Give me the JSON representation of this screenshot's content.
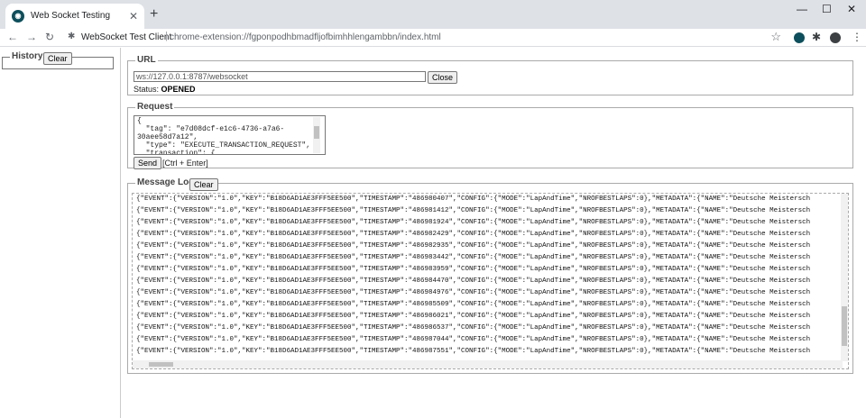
{
  "browser": {
    "tab_title": "Web Socket Testing",
    "tab_close": "✕",
    "new_tab": "+",
    "site_name": "WebSocket Test Client",
    "url": "chrome-extension://fgponpodhbmadfljofbimhhlengambbn/index.html",
    "win_min": "—",
    "win_max": "☐",
    "win_close": "✕"
  },
  "history": {
    "legend": "History",
    "clear_label": "Clear"
  },
  "url_section": {
    "legend": "URL",
    "input_value": "ws://127.0.0.1:8787/websocket",
    "close_label": "Close",
    "status_label": "Status:",
    "status_value": "OPENED"
  },
  "request": {
    "legend": "Request",
    "text": "{\n  \"tag\": \"e7d08dcf-e1c6-4736-a7a6-\n30aee58d7a12\",\n  \"type\": \"EXECUTE_TRANSACTION_REQUEST\",\n  \"transaction\": {",
    "send_label": "Send",
    "hint": "[Ctrl + Enter]"
  },
  "log": {
    "legend": "Message Log",
    "clear_label": "Clear",
    "lines": [
      "{\"EVENT\":{\"VERSION\":\"1.0\",\"KEY\":\"B18D6AD1AE3FFF5EE500\",\"TIMESTAMP\":\"486980407\",\"CONFIG\":{\"MODE\":\"LapAndTime\",\"NROFBESTLAPS\":0},\"METADATA\":{\"NAME\":\"Deutsche Meistersch",
      "{\"EVENT\":{\"VERSION\":\"1.0\",\"KEY\":\"B18D6AD1AE3FFF5EE500\",\"TIMESTAMP\":\"486981412\",\"CONFIG\":{\"MODE\":\"LapAndTime\",\"NROFBESTLAPS\":0},\"METADATA\":{\"NAME\":\"Deutsche Meistersch",
      "{\"EVENT\":{\"VERSION\":\"1.0\",\"KEY\":\"B18D6AD1AE3FFF5EE500\",\"TIMESTAMP\":\"486981924\",\"CONFIG\":{\"MODE\":\"LapAndTime\",\"NROFBESTLAPS\":0},\"METADATA\":{\"NAME\":\"Deutsche Meistersch",
      "{\"EVENT\":{\"VERSION\":\"1.0\",\"KEY\":\"B18D6AD1AE3FFF5EE500\",\"TIMESTAMP\":\"486982429\",\"CONFIG\":{\"MODE\":\"LapAndTime\",\"NROFBESTLAPS\":0},\"METADATA\":{\"NAME\":\"Deutsche Meistersch",
      "{\"EVENT\":{\"VERSION\":\"1.0\",\"KEY\":\"B18D6AD1AE3FFF5EE500\",\"TIMESTAMP\":\"486982935\",\"CONFIG\":{\"MODE\":\"LapAndTime\",\"NROFBESTLAPS\":0},\"METADATA\":{\"NAME\":\"Deutsche Meistersch",
      "{\"EVENT\":{\"VERSION\":\"1.0\",\"KEY\":\"B18D6AD1AE3FFF5EE500\",\"TIMESTAMP\":\"486983442\",\"CONFIG\":{\"MODE\":\"LapAndTime\",\"NROFBESTLAPS\":0},\"METADATA\":{\"NAME\":\"Deutsche Meistersch",
      "{\"EVENT\":{\"VERSION\":\"1.0\",\"KEY\":\"B18D6AD1AE3FFF5EE500\",\"TIMESTAMP\":\"486983959\",\"CONFIG\":{\"MODE\":\"LapAndTime\",\"NROFBESTLAPS\":0},\"METADATA\":{\"NAME\":\"Deutsche Meistersch",
      "{\"EVENT\":{\"VERSION\":\"1.0\",\"KEY\":\"B18D6AD1AE3FFF5EE500\",\"TIMESTAMP\":\"486984470\",\"CONFIG\":{\"MODE\":\"LapAndTime\",\"NROFBESTLAPS\":0},\"METADATA\":{\"NAME\":\"Deutsche Meistersch",
      "{\"EVENT\":{\"VERSION\":\"1.0\",\"KEY\":\"B18D6AD1AE3FFF5EE500\",\"TIMESTAMP\":\"486984976\",\"CONFIG\":{\"MODE\":\"LapAndTime\",\"NROFBESTLAPS\":0},\"METADATA\":{\"NAME\":\"Deutsche Meistersch",
      "{\"EVENT\":{\"VERSION\":\"1.0\",\"KEY\":\"B18D6AD1AE3FFF5EE500\",\"TIMESTAMP\":\"486985509\",\"CONFIG\":{\"MODE\":\"LapAndTime\",\"NROFBESTLAPS\":0},\"METADATA\":{\"NAME\":\"Deutsche Meistersch",
      "{\"EVENT\":{\"VERSION\":\"1.0\",\"KEY\":\"B18D6AD1AE3FFF5EE500\",\"TIMESTAMP\":\"486986021\",\"CONFIG\":{\"MODE\":\"LapAndTime\",\"NROFBESTLAPS\":0},\"METADATA\":{\"NAME\":\"Deutsche Meistersch",
      "{\"EVENT\":{\"VERSION\":\"1.0\",\"KEY\":\"B18D6AD1AE3FFF5EE500\",\"TIMESTAMP\":\"486986537\",\"CONFIG\":{\"MODE\":\"LapAndTime\",\"NROFBESTLAPS\":0},\"METADATA\":{\"NAME\":\"Deutsche Meistersch",
      "{\"EVENT\":{\"VERSION\":\"1.0\",\"KEY\":\"B18D6AD1AE3FFF5EE500\",\"TIMESTAMP\":\"486987044\",\"CONFIG\":{\"MODE\":\"LapAndTime\",\"NROFBESTLAPS\":0},\"METADATA\":{\"NAME\":\"Deutsche Meistersch",
      "{\"EVENT\":{\"VERSION\":\"1.0\",\"KEY\":\"B18D6AD1AE3FFF5EE500\",\"TIMESTAMP\":\"486987551\",\"CONFIG\":{\"MODE\":\"LapAndTime\",\"NROFBESTLAPS\":0},\"METADATA\":{\"NAME\":\"Deutsche Meistersch"
    ]
  }
}
